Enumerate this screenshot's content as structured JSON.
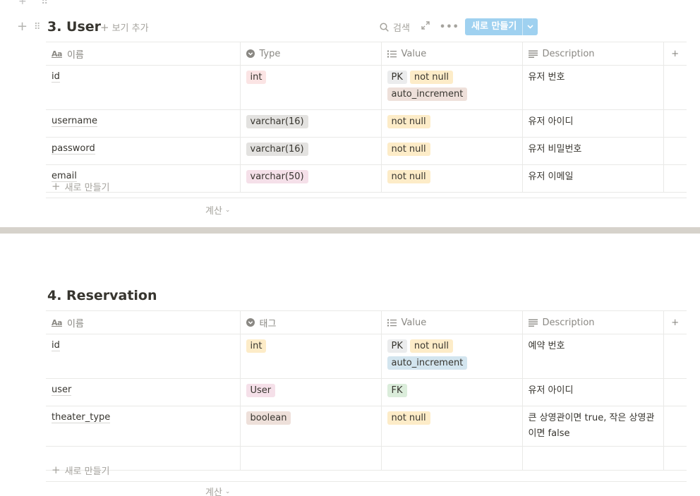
{
  "databases": [
    {
      "title": "3. User",
      "add_view_label": "보기 추가",
      "search_label": "검색",
      "new_button_label": "새로 만들기",
      "columns": {
        "name": "이름",
        "type": "Type",
        "value": "Value",
        "description": "Description"
      },
      "rows": [
        {
          "name": "id",
          "type": [
            {
              "text": "int",
              "color": "#fbe4e4"
            }
          ],
          "value": [
            {
              "text": "PK",
              "color": "#ebeced"
            },
            {
              "text": "not null",
              "color": "#fdecc8"
            },
            {
              "text": "auto_increment",
              "color": "#eee0da"
            }
          ],
          "description": "유저 번호"
        },
        {
          "name": "username",
          "type": [
            {
              "text": "varchar(16)",
              "color": "#e3e2e0"
            }
          ],
          "value": [
            {
              "text": "not null",
              "color": "#fdecc8"
            }
          ],
          "description": "유저 아이디"
        },
        {
          "name": "password",
          "type": [
            {
              "text": "varchar(16)",
              "color": "#e3e2e0"
            }
          ],
          "value": [
            {
              "text": "not null",
              "color": "#fdecc8"
            }
          ],
          "description": "유저 비밀번호"
        },
        {
          "name": "email",
          "type": [
            {
              "text": "varchar(50)",
              "color": "#f5e0e9"
            }
          ],
          "value": [
            {
              "text": "not null",
              "color": "#fdecc8"
            }
          ],
          "description": "유저 이메일"
        }
      ],
      "add_row_label": "새로 만들기",
      "calc_label": "계산"
    },
    {
      "title": "4. Reservation",
      "columns": {
        "name": "이름",
        "type": "태그",
        "value": "Value",
        "description": "Description"
      },
      "rows": [
        {
          "name": "id",
          "type": [
            {
              "text": "int",
              "color": "#fdecc8"
            }
          ],
          "value": [
            {
              "text": "PK",
              "color": "#ebeced"
            },
            {
              "text": "not null",
              "color": "#fdecc8"
            },
            {
              "text": "auto_increment",
              "color": "#d3e5ef"
            }
          ],
          "description": "예약 번호"
        },
        {
          "name": "user",
          "type": [
            {
              "text": "User",
              "color": "#f5e0e9"
            }
          ],
          "value": [
            {
              "text": "FK",
              "color": "#dbeddb"
            }
          ],
          "description": "유저 아이디"
        },
        {
          "name": "theater_type",
          "type": [
            {
              "text": "boolean",
              "color": "#eee0da"
            }
          ],
          "value": [
            {
              "text": "not null",
              "color": "#fdecc8"
            }
          ],
          "description": "큰 상영관이면 true, 작은 상영관이면 false"
        },
        {
          "name": "",
          "type": [],
          "value": [],
          "description": ""
        }
      ],
      "add_row_label": "새로 만들기",
      "calc_label": "계산"
    }
  ]
}
